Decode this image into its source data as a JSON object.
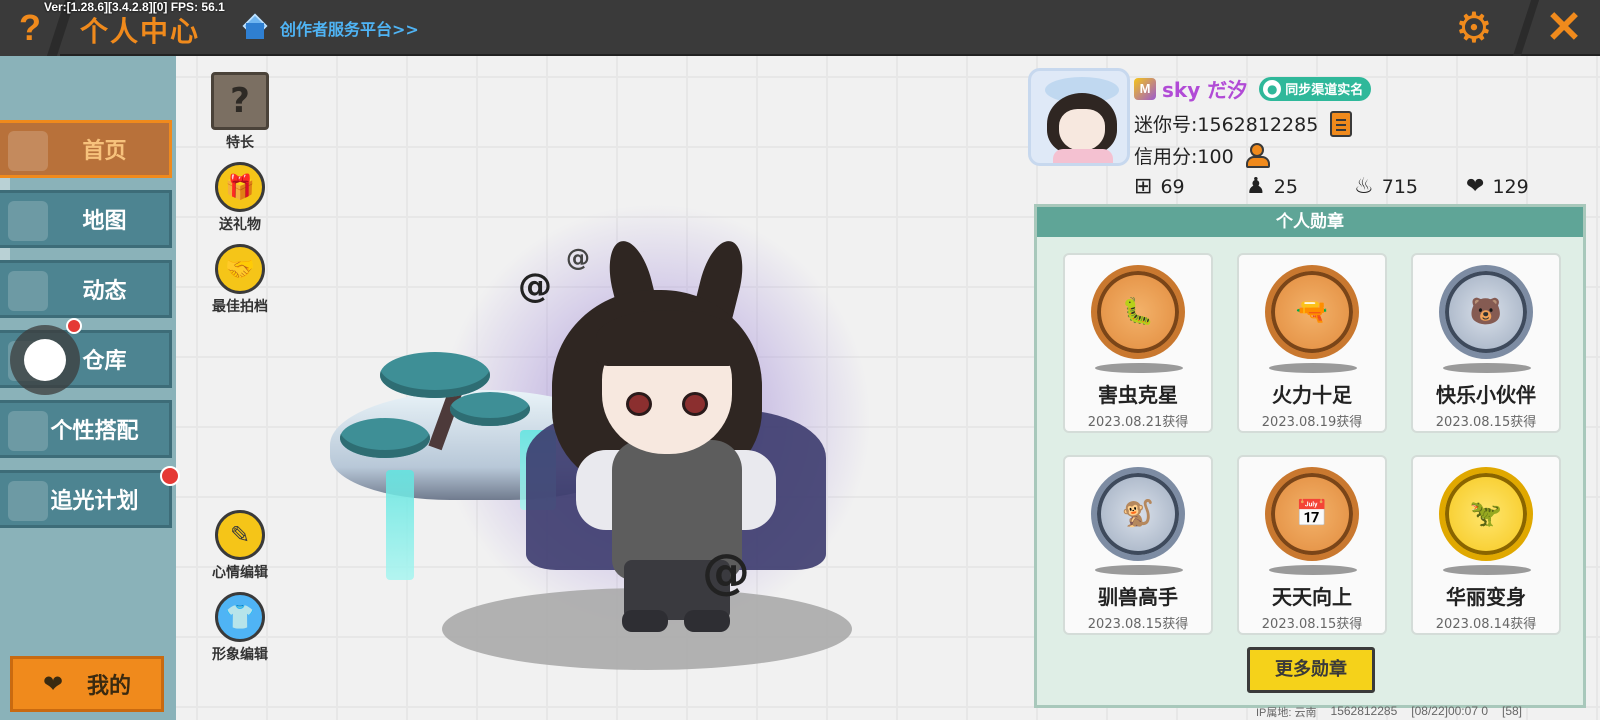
{
  "topbar": {
    "version": "Ver:[1.28.6][3.4.2.8][0] FPS: 56.1",
    "title": "个人中心",
    "creator_link": "创作者服务平台>>",
    "help_glyph": "?",
    "close_glyph": "✕",
    "gear_glyph": "⚙"
  },
  "sidebar": {
    "items": [
      {
        "label": "首页",
        "active": true
      },
      {
        "label": "地图"
      },
      {
        "label": "动态"
      },
      {
        "label": "仓库"
      },
      {
        "label": "个性搭配"
      },
      {
        "label": "追光计划"
      }
    ],
    "mine_label": "我的"
  },
  "tools": {
    "specialty": "特长",
    "gift": "送礼物",
    "partner": "最佳拍档",
    "mood_edit": "心情编辑",
    "avatar_edit": "形象编辑"
  },
  "profile": {
    "name": "sky だ汐",
    "badge": "M",
    "realname_tag": "同步渠道实名",
    "mini_id": "迷你号:1562812285",
    "credit": "信用分:100",
    "stats": [
      {
        "icon": "add-flag-icon",
        "value": "69"
      },
      {
        "icon": "fans-icon",
        "value": "25"
      },
      {
        "icon": "fire-icon",
        "value": "715"
      },
      {
        "icon": "heart-icon",
        "value": "129"
      }
    ]
  },
  "medals": {
    "header": "个人勋章",
    "items": [
      {
        "name": "害虫克星",
        "date": "2023.08.21获得",
        "tier": "bronze"
      },
      {
        "name": "火力十足",
        "date": "2023.08.19获得",
        "tier": "bronze"
      },
      {
        "name": "快乐小伙伴",
        "date": "2023.08.15获得",
        "tier": "silver"
      },
      {
        "name": "驯兽高手",
        "date": "2023.08.15获得",
        "tier": "silver"
      },
      {
        "name": "天天向上",
        "date": "2023.08.15获得",
        "tier": "bronze"
      },
      {
        "name": "华丽变身",
        "date": "2023.08.14获得",
        "tier": "gold"
      }
    ],
    "more_label": "更多勋章"
  },
  "footer": {
    "ip": "IP属地: 云南",
    "uid": "1562812285",
    "time": "[08/22]00:07 0",
    "tail": "[58]"
  }
}
